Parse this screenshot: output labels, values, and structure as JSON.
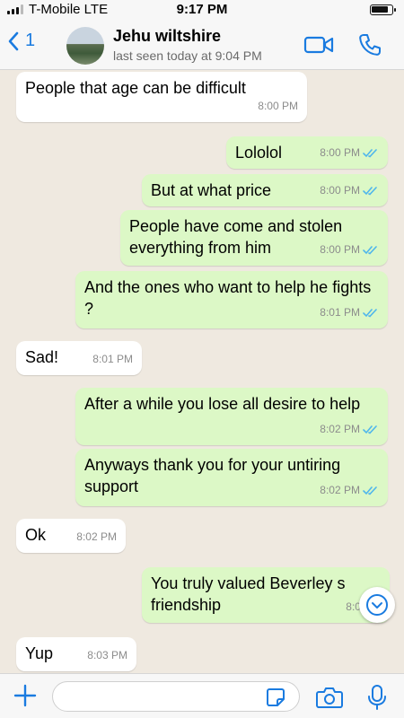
{
  "status_bar": {
    "carrier": "T-Mobile  LTE",
    "time": "9:17 PM"
  },
  "header": {
    "back_count": "1",
    "contact_name": "Jehu wiltshire",
    "last_seen": "last seen today at 9:04 PM"
  },
  "messages": [
    {
      "direction": "in",
      "text": "People that age can be difficult",
      "time": "8:00 PM"
    },
    {
      "direction": "out",
      "text": "Lololol",
      "time": "8:00 PM"
    },
    {
      "direction": "out",
      "text": "But at what price",
      "time": "8:00 PM"
    },
    {
      "direction": "out",
      "text": "People have come and stolen everything from him",
      "time": "8:00 PM"
    },
    {
      "direction": "out",
      "text": "And the ones who want to help he fights ?",
      "time": "8:01 PM"
    },
    {
      "direction": "in",
      "text": "Sad!",
      "time": "8:01 PM"
    },
    {
      "direction": "out",
      "text": "After a while you lose all desire to help",
      "time": "8:02 PM"
    },
    {
      "direction": "out",
      "text": "Anyways thank you for your untiring support",
      "time": "8:02 PM"
    },
    {
      "direction": "in",
      "text": "Ok",
      "time": "8:02 PM"
    },
    {
      "direction": "out",
      "text": "You truly valued Beverley s friendship",
      "time": "8:03 P"
    },
    {
      "direction": "in",
      "text": "Yup",
      "time": "8:03 PM"
    }
  ],
  "colors": {
    "accent": "#1a7be0",
    "outgoing_bubble": "#dcf8c6",
    "incoming_bubble": "#ffffff",
    "read_check": "#4fb6ec"
  },
  "icons": {
    "back": "chevron-left-icon",
    "video": "video-call-icon",
    "call": "phone-icon",
    "read": "double-check-icon",
    "scroll": "chevron-down-icon",
    "plus": "plus-icon",
    "sticker": "sticker-icon",
    "camera": "camera-icon",
    "mic": "microphone-icon"
  }
}
